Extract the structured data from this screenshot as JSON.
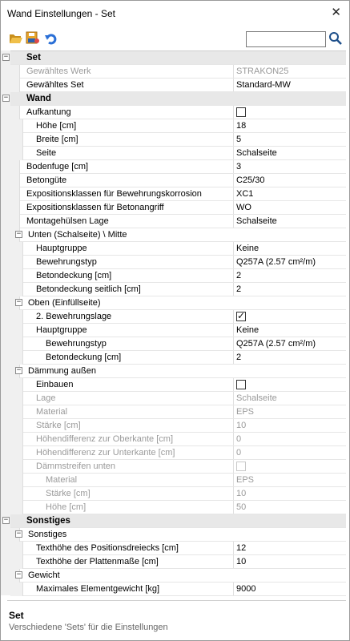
{
  "window": {
    "title": "Wand Einstellungen - Set",
    "close_glyph": "✕"
  },
  "toolbar": {
    "icons": [
      "folder-open-icon",
      "save-user-icon",
      "undo-icon"
    ],
    "search_value": "",
    "search_icon": "magnifier-icon"
  },
  "colors": {
    "section_bg": "#e8e8e8",
    "muted_text": "#9a9a9a",
    "folder": "#e8b33a",
    "undo": "#2a6fd6"
  },
  "rows": [
    {
      "kind": "section",
      "label": "Set",
      "toggle": "−"
    },
    {
      "kind": "prop",
      "level": 1,
      "label": "Gewähltes Werk",
      "value": "STRAKON25",
      "muted": true
    },
    {
      "kind": "prop",
      "level": 1,
      "label": "Gewähltes Set",
      "value": "Standard-MW"
    },
    {
      "kind": "section",
      "label": "Wand",
      "toggle": "−"
    },
    {
      "kind": "prop",
      "level": 1,
      "label": "Aufkantung",
      "checkbox": false
    },
    {
      "kind": "prop",
      "level": 2,
      "label": "Höhe [cm]",
      "value": "18"
    },
    {
      "kind": "prop",
      "level": 2,
      "label": "Breite [cm]",
      "value": "5"
    },
    {
      "kind": "prop",
      "level": 2,
      "label": "Seite",
      "value": "Schalseite"
    },
    {
      "kind": "prop",
      "level": 1,
      "label": "Bodenfuge [cm]",
      "value": "3"
    },
    {
      "kind": "prop",
      "level": 1,
      "label": "Betongüte",
      "value": "C25/30"
    },
    {
      "kind": "prop",
      "level": 1,
      "label": "Expositionsklassen für Bewehrungskorrosion",
      "value": "XC1"
    },
    {
      "kind": "prop",
      "level": 1,
      "label": "Expositionsklassen für Betonangriff",
      "value": "WO"
    },
    {
      "kind": "prop",
      "level": 1,
      "label": "Montagehülsen Lage",
      "value": "Schalseite"
    },
    {
      "kind": "subsection",
      "level": 1,
      "label": "Unten (Schalseite) \\ Mitte",
      "toggle": "−"
    },
    {
      "kind": "prop",
      "level": 2,
      "label": "Hauptgruppe",
      "value": "Keine"
    },
    {
      "kind": "prop",
      "level": 2,
      "label": "Bewehrungstyp",
      "value": "Q257A   (2.57 cm²/m)"
    },
    {
      "kind": "prop",
      "level": 2,
      "label": "Betondeckung [cm]",
      "value": "2"
    },
    {
      "kind": "prop",
      "level": 2,
      "label": "Betondeckung seitlich [cm]",
      "value": "2"
    },
    {
      "kind": "subsection",
      "level": 1,
      "label": "Oben (Einfüllseite)",
      "toggle": "−"
    },
    {
      "kind": "prop",
      "level": 2,
      "label": "2. Bewehrungslage",
      "checkbox": true
    },
    {
      "kind": "prop",
      "level": 2,
      "label": "Hauptgruppe",
      "value": "Keine"
    },
    {
      "kind": "prop",
      "level": 3,
      "label": "Bewehrungstyp",
      "value": "Q257A   (2.57 cm²/m)"
    },
    {
      "kind": "prop",
      "level": 3,
      "label": "Betondeckung [cm]",
      "value": "2"
    },
    {
      "kind": "subsection",
      "level": 1,
      "label": "Dämmung außen",
      "toggle": "−"
    },
    {
      "kind": "prop",
      "level": 2,
      "label": "Einbauen",
      "checkbox": false
    },
    {
      "kind": "prop",
      "level": 2,
      "label": "Lage",
      "value": "Schalseite",
      "muted": true
    },
    {
      "kind": "prop",
      "level": 2,
      "label": "Material",
      "value": "EPS",
      "muted": true
    },
    {
      "kind": "prop",
      "level": 2,
      "label": "Stärke [cm]",
      "value": "10",
      "muted": true
    },
    {
      "kind": "prop",
      "level": 2,
      "label": "Höhendifferenz zur Oberkante [cm]",
      "value": "0",
      "muted": true
    },
    {
      "kind": "prop",
      "level": 2,
      "label": "Höhendifferenz zur Unterkante [cm]",
      "value": "0",
      "muted": true
    },
    {
      "kind": "prop",
      "level": 2,
      "label": "Dämmstreifen unten",
      "checkbox": false,
      "muted": true
    },
    {
      "kind": "prop",
      "level": 3,
      "label": "Material",
      "value": "EPS",
      "muted": true
    },
    {
      "kind": "prop",
      "level": 3,
      "label": "Stärke [cm]",
      "value": "10",
      "muted": true
    },
    {
      "kind": "prop",
      "level": 3,
      "label": "Höhe [cm]",
      "value": "50",
      "muted": true
    },
    {
      "kind": "section",
      "label": "Sonstiges",
      "toggle": "−"
    },
    {
      "kind": "subsection",
      "level": 1,
      "label": "Sonstiges",
      "toggle": "−"
    },
    {
      "kind": "prop",
      "level": 2,
      "label": "Texthöhe des Positionsdreiecks [cm]",
      "value": "12"
    },
    {
      "kind": "prop",
      "level": 2,
      "label": "Texthöhe der Plattenmaße [cm]",
      "value": "10"
    },
    {
      "kind": "subsection",
      "level": 1,
      "label": "Gewicht",
      "toggle": "−"
    },
    {
      "kind": "prop",
      "level": 2,
      "label": "Maximales Elementgewicht [kg]",
      "value": "9000"
    }
  ],
  "description": {
    "title": "Set",
    "text": "Verschiedene 'Sets' für die Einstellungen"
  }
}
